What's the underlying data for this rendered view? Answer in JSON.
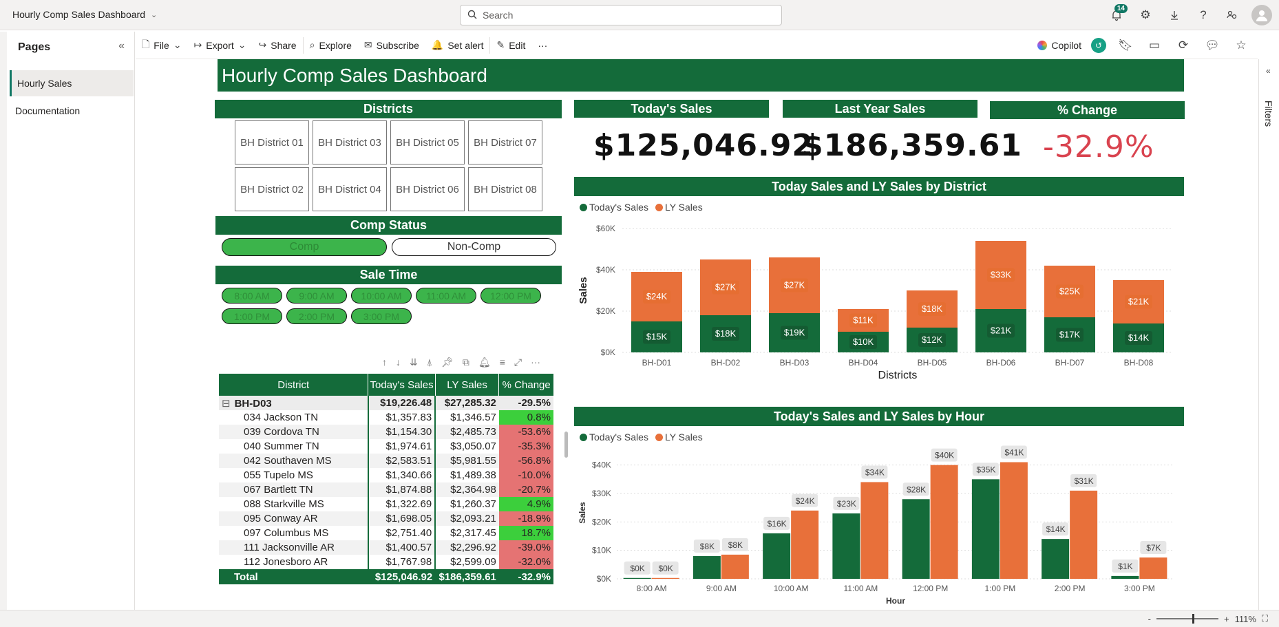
{
  "app": {
    "title": "Hourly Comp Sales Dashboard",
    "search_placeholder": "Search",
    "notifications": "14"
  },
  "sidebar": {
    "title": "Pages",
    "items": [
      {
        "label": "Hourly Sales"
      },
      {
        "label": "Documentation"
      }
    ]
  },
  "toolbar": {
    "file": "File",
    "export": "Export",
    "share": "Share",
    "explore": "Explore",
    "subscribe": "Subscribe",
    "set_alert": "Set alert",
    "edit": "Edit",
    "more": "···",
    "copilot": "Copilot"
  },
  "filters_label": "Filters",
  "dashboard": {
    "title": "Hourly Comp Sales Dashboard",
    "districts_header": "Districts",
    "districts": [
      "BH District 01",
      "BH District 03",
      "BH District 05",
      "BH District 07",
      "BH District 02",
      "BH District 04",
      "BH District 06",
      "BH District 08"
    ],
    "comp_status_header": "Comp Status",
    "comp_options": [
      "Comp",
      "Non-Comp"
    ],
    "sale_time_header": "Sale Time",
    "sale_times": [
      "8:00 AM",
      "9:00 AM",
      "10:00 AM",
      "11:00 AM",
      "12:00 PM",
      "1:00 PM",
      "2:00 PM",
      "3:00 PM"
    ],
    "kpis": [
      {
        "label": "Today's Sales",
        "value": "$125,046.92"
      },
      {
        "label": "Last Year Sales",
        "value": "$186,359.61"
      },
      {
        "label": "% Change",
        "value": "-32.9%"
      }
    ]
  },
  "table": {
    "headers": [
      "District",
      "Today's Sales",
      "LY Sales",
      "% Change"
    ],
    "group": {
      "name": "BH-D03",
      "today": "$19,226.48",
      "ly": "$27,285.32",
      "pct": "-29.5%"
    },
    "rows": [
      {
        "name": "034 Jackson TN",
        "today": "$1,357.83",
        "ly": "$1,346.57",
        "pct": "0.8%",
        "status": "pos"
      },
      {
        "name": "039 Cordova TN",
        "today": "$1,154.30",
        "ly": "$2,485.73",
        "pct": "-53.6%",
        "status": "neg"
      },
      {
        "name": "040 Summer TN",
        "today": "$1,974.61",
        "ly": "$3,050.07",
        "pct": "-35.3%",
        "status": "neg"
      },
      {
        "name": "042 Southaven MS",
        "today": "$2,583.51",
        "ly": "$5,981.55",
        "pct": "-56.8%",
        "status": "neg"
      },
      {
        "name": "055 Tupelo MS",
        "today": "$1,340.66",
        "ly": "$1,489.38",
        "pct": "-10.0%",
        "status": "neg"
      },
      {
        "name": "067 Bartlett TN",
        "today": "$1,874.88",
        "ly": "$2,364.98",
        "pct": "-20.7%",
        "status": "neg"
      },
      {
        "name": "088 Starkville MS",
        "today": "$1,322.69",
        "ly": "$1,260.37",
        "pct": "4.9%",
        "status": "pos"
      },
      {
        "name": "095 Conway AR",
        "today": "$1,698.05",
        "ly": "$2,093.21",
        "pct": "-18.9%",
        "status": "neg"
      },
      {
        "name": "097 Columbus MS",
        "today": "$2,751.40",
        "ly": "$2,317.45",
        "pct": "18.7%",
        "status": "pos"
      },
      {
        "name": "111 Jacksonville AR",
        "today": "$1,400.57",
        "ly": "$2,296.92",
        "pct": "-39.0%",
        "status": "neg"
      },
      {
        "name": "112 Jonesboro AR",
        "today": "$1,767.98",
        "ly": "$2,599.09",
        "pct": "-32.0%",
        "status": "neg"
      }
    ],
    "total": {
      "name": "Total",
      "today": "$125,046.92",
      "ly": "$186,359.61",
      "pct": "-32.9%"
    }
  },
  "colors": {
    "green": "#146b3a",
    "orange": "#e8703a",
    "positive": "#3ccf3c",
    "negative": "#e57373",
    "kpi_negative": "#d9434f"
  },
  "zoom": "111%",
  "chart_data": [
    {
      "type": "bar",
      "stacked": true,
      "title": "Today Sales and LY Sales by District",
      "xlabel": "Districts",
      "ylabel": "Sales",
      "categories": [
        "BH-D01",
        "BH-D02",
        "BH-D03",
        "BH-D04",
        "BH-D05",
        "BH-D06",
        "BH-D07",
        "BH-D08"
      ],
      "series": [
        {
          "name": "Today's Sales",
          "values": [
            15,
            18,
            19,
            10,
            12,
            21,
            17,
            14
          ],
          "labels": [
            "$15K",
            "$18K",
            "$19K",
            "$10K",
            "$12K",
            "$21K",
            "$17K",
            "$14K"
          ]
        },
        {
          "name": "LY Sales",
          "values": [
            24,
            27,
            27,
            11,
            18,
            33,
            25,
            21
          ],
          "labels": [
            "$24K",
            "$27K",
            "$27K",
            "$11K",
            "$18K",
            "$33K",
            "$25K",
            "$21K"
          ]
        }
      ],
      "yticks": [
        "$0K",
        "$20K",
        "$40K",
        "$60K"
      ],
      "ylim": [
        0,
        60
      ],
      "legend": "top-left"
    },
    {
      "type": "bar",
      "title": "Today's Sales and LY Sales by Hour",
      "xlabel": "Hour",
      "ylabel": "Sales",
      "categories": [
        "8:00 AM",
        "9:00 AM",
        "10:00 AM",
        "11:00 AM",
        "12:00 PM",
        "1:00 PM",
        "2:00 PM",
        "3:00 PM"
      ],
      "series": [
        {
          "name": "Today's Sales",
          "values": [
            0.3,
            8,
            16,
            23,
            28,
            35,
            14,
            1
          ],
          "labels": [
            "$0K",
            "$8K",
            "$16K",
            "$23K",
            "$28K",
            "$35K",
            "$14K",
            "$1K"
          ]
        },
        {
          "name": "LY Sales",
          "values": [
            0.3,
            8.5,
            24,
            34,
            40,
            41,
            31,
            7.5
          ],
          "labels": [
            "$0K",
            "$8K",
            "$24K",
            "$34K",
            "$40K",
            "$41K",
            "$31K",
            "$7K"
          ]
        }
      ],
      "yticks": [
        "$0K",
        "$10K",
        "$20K",
        "$30K",
        "$40K"
      ],
      "ylim": [
        0,
        45
      ],
      "legend": "top-left"
    }
  ]
}
